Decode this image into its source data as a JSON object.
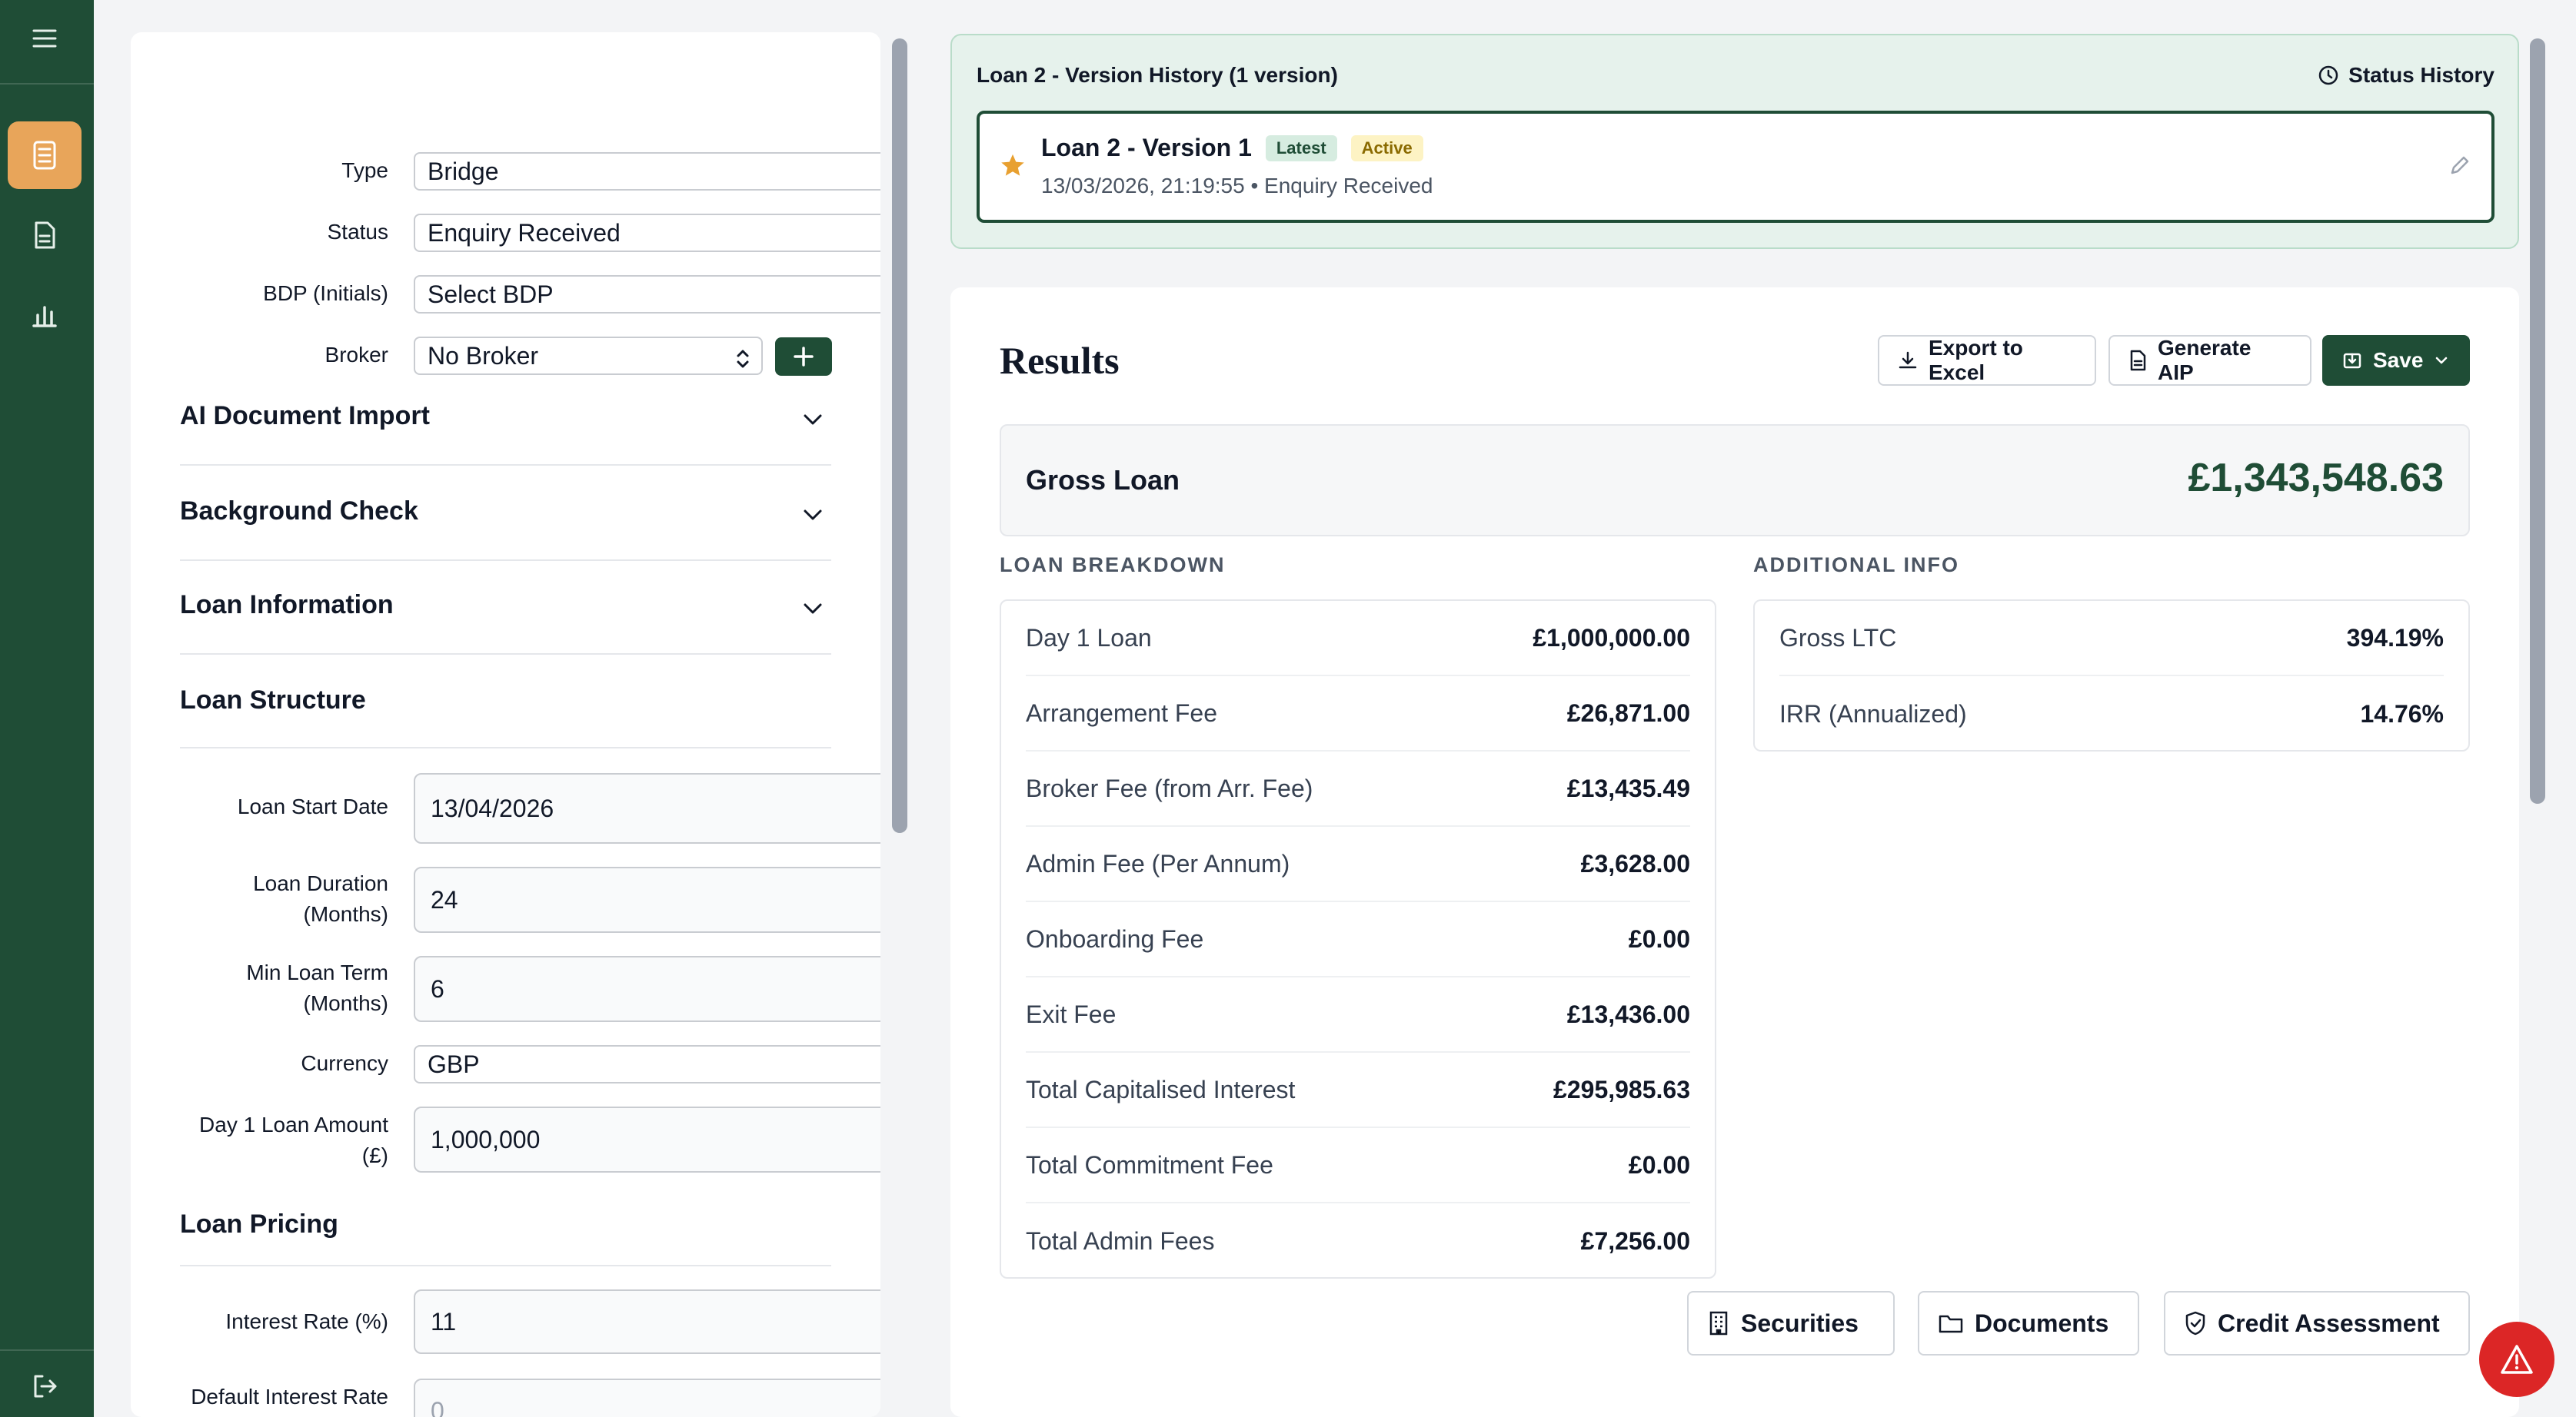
{
  "sidebar": {
    "items": [
      {
        "icon": "menu-icon"
      },
      {
        "icon": "calculator-icon"
      },
      {
        "icon": "document-icon"
      },
      {
        "icon": "bar-chart-icon"
      },
      {
        "icon": "logout-icon"
      }
    ]
  },
  "form": {
    "type": {
      "label": "Type",
      "value": "Bridge"
    },
    "status": {
      "label": "Status",
      "value": "Enquiry Received"
    },
    "bdp": {
      "label": "BDP (Initials)",
      "value": "Select BDP"
    },
    "broker": {
      "label": "Broker",
      "value": "No Broker"
    },
    "sections": {
      "ai_import": "AI Document Import",
      "background_check": "Background Check",
      "loan_information": "Loan Information",
      "loan_structure": "Loan Structure",
      "loan_pricing": "Loan Pricing"
    },
    "loan_start_date": {
      "label": "Loan Start Date",
      "value": "13/04/2026"
    },
    "loan_duration": {
      "label_1": "Loan Duration",
      "label_2": "(Months)",
      "value": "24"
    },
    "min_loan_term": {
      "label_1": "Min Loan Term",
      "label_2": "(Months)",
      "value": "6"
    },
    "currency": {
      "label": "Currency",
      "value": "GBP"
    },
    "day1_amount": {
      "label_1": "Day 1 Loan Amount",
      "label_2": "(£)",
      "value": "1,000,000"
    },
    "interest_rate": {
      "label": "Interest Rate (%)",
      "value": "11"
    },
    "default_interest": {
      "label_1": "Default Interest Rate",
      "label_2": "(%)",
      "placeholder": "0"
    }
  },
  "version_history": {
    "title": "Loan 2 - Version History (1 version)",
    "status_history": "Status History",
    "version_name": "Loan 2 - Version 1",
    "badge_latest": "Latest",
    "badge_active": "Active",
    "subtitle": "13/03/2026, 21:19:55 • Enquiry Received"
  },
  "results": {
    "title": "Results",
    "export_label": "Export to Excel",
    "aip_label": "Generate AIP",
    "save_label": "Save",
    "gross_loan_label": "Gross Loan",
    "gross_loan_value": "£1,343,548.63",
    "breakdown_title": "LOAN BREAKDOWN",
    "additional_title": "ADDITIONAL INFO",
    "breakdown": [
      {
        "k": "Day 1 Loan",
        "v": "£1,000,000.00"
      },
      {
        "k": "Arrangement Fee",
        "v": "£26,871.00"
      },
      {
        "k": "Broker Fee (from Arr. Fee)",
        "v": "£13,435.49"
      },
      {
        "k": "Admin Fee (Per Annum)",
        "v": "£3,628.00"
      },
      {
        "k": "Onboarding Fee",
        "v": "£0.00"
      },
      {
        "k": "Exit Fee",
        "v": "£13,436.00"
      },
      {
        "k": "Total Capitalised Interest",
        "v": "£295,985.63"
      },
      {
        "k": "Total Commitment Fee",
        "v": "£0.00"
      },
      {
        "k": "Total Admin Fees",
        "v": "£7,256.00"
      }
    ],
    "additional": [
      {
        "k": "Gross LTC",
        "v": "394.19%"
      },
      {
        "k": "IRR (Annualized)",
        "v": "14.76%"
      }
    ],
    "securities_label": "Securities",
    "documents_label": "Documents",
    "credit_label": "Credit Assessment"
  },
  "colors": {
    "brand": "#1f4d36",
    "accent": "#e8a55a",
    "alert": "#dc2626"
  }
}
